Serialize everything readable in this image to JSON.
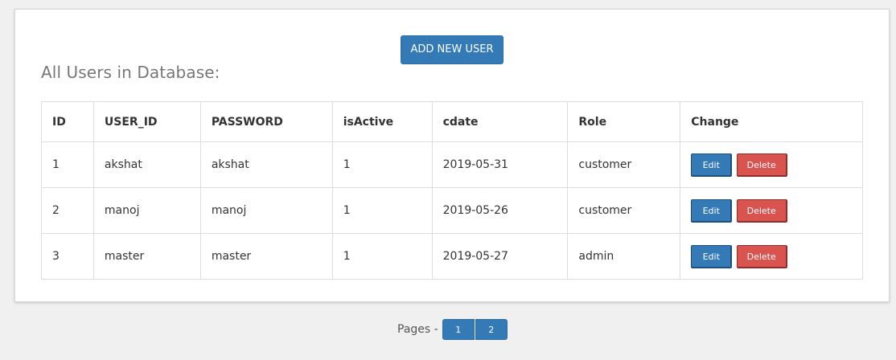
{
  "toolbar": {
    "add_user_label": "ADD NEW USER"
  },
  "heading": "All Users in Database:",
  "table": {
    "columns": [
      "ID",
      "USER_ID",
      "PASSWORD",
      "isActive",
      "cdate",
      "Role",
      "Change"
    ],
    "rows": [
      {
        "id": "1",
        "user_id": "akshat",
        "password": "akshat",
        "is_active": "1",
        "cdate": "2019-05-31",
        "role": "customer"
      },
      {
        "id": "2",
        "user_id": "manoj",
        "password": "manoj",
        "is_active": "1",
        "cdate": "2019-05-26",
        "role": "customer"
      },
      {
        "id": "3",
        "user_id": "master",
        "password": "master",
        "is_active": "1",
        "cdate": "2019-05-27",
        "role": "admin"
      }
    ],
    "edit_label": "Edit",
    "delete_label": "Delete"
  },
  "pager": {
    "label": "Pages -",
    "pages": [
      "1",
      "2"
    ]
  },
  "colors": {
    "primary": "#337ab7",
    "danger": "#d9534f",
    "background": "#f0f0f0"
  }
}
